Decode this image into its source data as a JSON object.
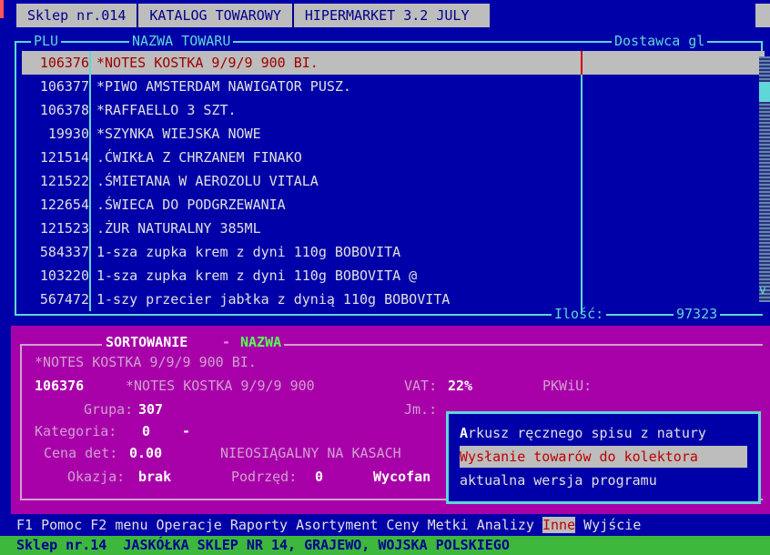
{
  "tabs": [
    "Sklep nr.014",
    "KATALOG TOWAROWY",
    "HIPERMARKET 3.2 JULY"
  ],
  "list": {
    "headers": {
      "plu": "PLU",
      "name": "NAZWA TOWARU",
      "supplier": "Dostawca gl"
    },
    "rows": [
      {
        "plu": "106376",
        "name": "*NOTES KOSTKA 9/9/9 900 BI."
      },
      {
        "plu": "106377",
        "name": "*PIWO AMSTERDAM NAWIGATOR PUSZ."
      },
      {
        "plu": "106378",
        "name": "*RAFFAELLO 3 SZT."
      },
      {
        "plu": "19930",
        "name": "*SZYNKA WIEJSKA NOWE"
      },
      {
        "plu": "121514",
        "name": ".ĆWIKŁA Z CHRZANEM FINAKO"
      },
      {
        "plu": "121522",
        "name": ".ŚMIETANA W AEROZOLU VITALA"
      },
      {
        "plu": "122654",
        "name": ".ŚWIECA DO PODGRZEWANIA"
      },
      {
        "plu": "121523",
        "name": ".ŻUR NATURALNY 385ML"
      },
      {
        "plu": "584337",
        "name": "1-sza zupka krem z dyni 110g BOBOVITA"
      },
      {
        "plu": "103220",
        "name": "1-sza zupka krem z dyni 110g BOBOVITA @"
      },
      {
        "plu": "567472",
        "name": "1-szy przecier jabłka z dynią 110g BOBOVITA"
      }
    ],
    "selected_index": 0,
    "qty_label": "Ilość:",
    "qty_value": "97323",
    "scroll_glyph": "v"
  },
  "details": {
    "sort_label": "SORTOWANIE",
    "sort_dash": "-",
    "sort_value": "NAZWA",
    "fullname": "*NOTES KOSTKA 9/9/9 900 BI.",
    "plu": "106376",
    "shortname": "*NOTES KOSTKA 9/9/9 900",
    "vat_label": "VAT:",
    "vat_value": "22%",
    "pkwiu_label": "PKWiU:",
    "grupa_label": "Grupa:",
    "grupa_value": "307",
    "jm_label": "Jm.:",
    "kategoria_label": "Kategoria:",
    "kategoria_value": "0",
    "kategoria_dash": "-",
    "cena_label": "Cena det:",
    "cena_value": "0.00",
    "niedost": "NIEOSIĄGALNY NA KASACH",
    "okazja_label": "Okazja:",
    "okazja_value": "brak",
    "podrzed_label": "Podrzęd:",
    "podrzed_value": "0",
    "wycofan": "Wycofan"
  },
  "popup": {
    "items": [
      {
        "hot": "A",
        "rest": "rkusz ręcznego spisu z natury"
      },
      {
        "hot": "",
        "rest": "Wysłanie towarów do kolektora"
      },
      {
        "hot": "",
        "rest": "aktualna wersja programu"
      }
    ],
    "selected_index": 1
  },
  "menubar": [
    "F1 Pomoc",
    "F2 menu",
    "Operacje",
    "Raporty",
    "Asortyment",
    "Ceny",
    "Metki",
    "Analizy",
    "Inne",
    "Wyjście"
  ],
  "menubar_active": "Inne",
  "status": "Sklep nr.14  JASKÓŁKA SKLEP NR 14, GRAJEWO, WOJSKA POLSKIEGO",
  "colors": {
    "background": "#0000a8",
    "frame": "#5fd7d7",
    "detail_panel": "#a800a8",
    "highlight": "#bdbdbd",
    "status_bar": "#3db83d"
  }
}
